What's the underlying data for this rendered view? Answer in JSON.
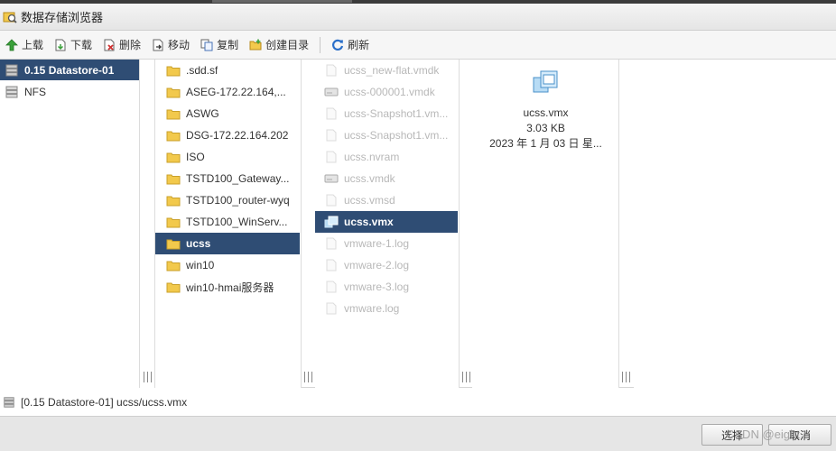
{
  "window": {
    "title": "数据存储浏览器"
  },
  "toolbar": {
    "upload": "上载",
    "download": "下载",
    "delete": "删除",
    "move": "移动",
    "copy": "复制",
    "create_dir": "创建目录",
    "refresh": "刷新"
  },
  "datastores": [
    {
      "label": "0.15 Datastore-01",
      "selected": true
    },
    {
      "label": "NFS",
      "selected": false
    }
  ],
  "folders": [
    ".sdd.sf",
    "ASEG-172.22.164,...",
    "ASWG",
    "DSG-172.22.164.202",
    "ISO",
    "TSTD100_Gateway...",
    "TSTD100_router-wyq",
    "TSTD100_WinServ...",
    "ucss",
    "win10",
    "win10-hmai服务器"
  ],
  "selected_folder_index": 8,
  "files": [
    {
      "name": "ucss_new-flat.vmdk",
      "icon": "file-icon"
    },
    {
      "name": "ucss-000001.vmdk",
      "icon": "disk-icon"
    },
    {
      "name": "ucss-Snapshot1.vm...",
      "icon": "file-icon"
    },
    {
      "name": "ucss-Snapshot1.vm...",
      "icon": "file-icon"
    },
    {
      "name": "ucss.nvram",
      "icon": "file-icon"
    },
    {
      "name": "ucss.vmdk",
      "icon": "disk-icon"
    },
    {
      "name": "ucss.vmsd",
      "icon": "file-icon"
    },
    {
      "name": "ucss.vmx",
      "icon": "vm-icon"
    },
    {
      "name": "vmware-1.log",
      "icon": "file-icon"
    },
    {
      "name": "vmware-2.log",
      "icon": "file-icon"
    },
    {
      "name": "vmware-3.log",
      "icon": "file-icon"
    },
    {
      "name": "vmware.log",
      "icon": "file-icon"
    }
  ],
  "selected_file_index": 7,
  "details": {
    "name": "ucss.vmx",
    "size": "3.03 KB",
    "date": "2023 年 1 月 03 日 星..."
  },
  "status": {
    "path": "[0.15 Datastore-01] ucss/ucss.vmx"
  },
  "footer": {
    "select": "选择",
    "cancel": "取消",
    "watermark": "CSDN @eight *"
  },
  "colors": {
    "selection": "#2f4d74",
    "folder": "#f2c94c",
    "upload_arrow": "#3aa13a",
    "refresh": "#2a6fc9"
  }
}
